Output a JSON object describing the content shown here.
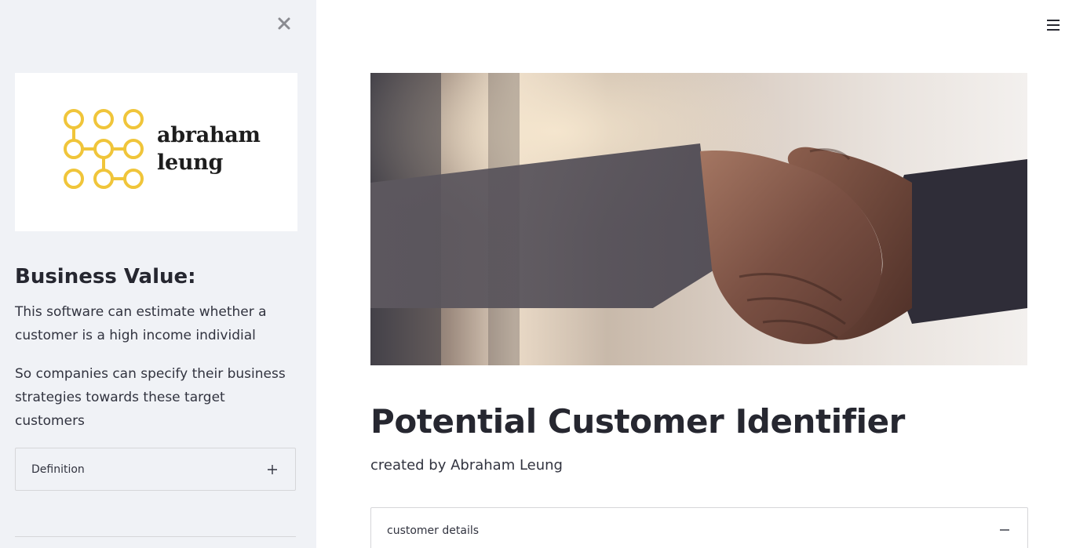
{
  "sidebar": {
    "close_icon": "close-icon",
    "logo": {
      "line1": "abraham",
      "line2": "leung",
      "mark_color": "#f0c53a"
    },
    "heading": "Business Value:",
    "paragraph1": "This software can estimate whether a customer is a high income individial",
    "paragraph2": "So companies can specify their business strategies towards these target customers",
    "expander": {
      "label": "Definition",
      "icon": "plus-icon"
    }
  },
  "header": {
    "menu_icon": "hamburger-menu-icon"
  },
  "main": {
    "hero_image": "handshake-photo",
    "title": "Potential Customer Identifier",
    "subtitle": "created by Abraham Leung",
    "expander": {
      "label": "customer details",
      "icon": "minus-icon"
    }
  },
  "colors": {
    "sidebar_bg": "#f0f2f6",
    "text": "#262730",
    "border": "#d6d6d9"
  }
}
